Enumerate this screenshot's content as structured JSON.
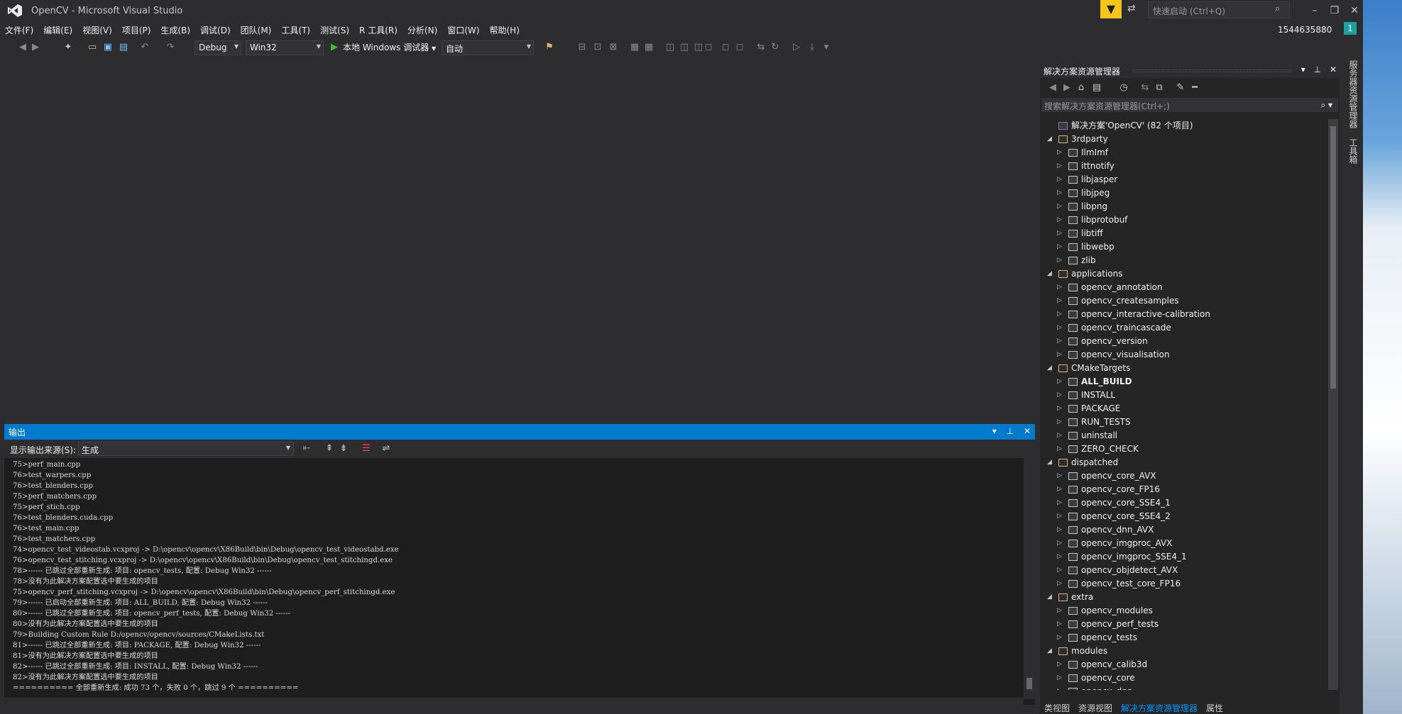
{
  "window": {
    "title": "OpenCV - Microsoft Visual Studio",
    "quick_launch_placeholder": "快速启动 (Ctrl+Q)",
    "user_id": "1544635880",
    "user_badge": "1"
  },
  "menu": [
    "文件(F)",
    "编辑(E)",
    "视图(V)",
    "项目(P)",
    "生成(B)",
    "调试(D)",
    "团队(M)",
    "工具(T)",
    "测试(S)",
    "R 工具(R)",
    "分析(N)",
    "窗口(W)",
    "帮助(H)"
  ],
  "toolbar": {
    "configuration": "Debug",
    "platform": "Win32",
    "run_label": "本地 Windows 调试器",
    "run_mode": "自动"
  },
  "output": {
    "title": "输出",
    "source_label": "显示输出来源(S):",
    "source_value": "生成",
    "lines": [
      "75>perf_main.cpp",
      "76>test_warpers.cpp",
      "76>test_blenders.cpp",
      "75>perf_matchers.cpp",
      "75>perf_stich.cpp",
      "76>test_blenders.cuda.cpp",
      "76>test_main.cpp",
      "76>test_matchers.cpp",
      "74>opencv_test_videostab.vcxproj -> D:\\opencv\\opencv\\X86Build\\bin\\Debug\\opencv_test_videostabd.exe",
      "76>opencv_test_stitching.vcxproj -> D:\\opencv\\opencv\\X86Build\\bin\\Debug\\opencv_test_stitchingd.exe",
      "78>------ 已跳过全部重新生成: 项目: opencv_tests, 配置: Debug Win32 ------",
      "78>没有为此解决方案配置选中要生成的项目",
      "75>opencv_perf_stitching.vcxproj -> D:\\opencv\\opencv\\X86Build\\bin\\Debug\\opencv_perf_stitchingd.exe",
      "79>------ 已启动全部重新生成: 项目: ALL_BUILD, 配置: Debug Win32 ------",
      "80>------ 已跳过全部重新生成: 项目: opencv_perf_tests, 配置: Debug Win32 ------",
      "80>没有为此解决方案配置选中要生成的项目",
      "79>Building Custom Rule D:/opencv/opencv/sources/CMakeLists.txt",
      "81>------ 已跳过全部重新生成: 项目: PACKAGE, 配置: Debug Win32 ------",
      "81>没有为此解决方案配置选中要生成的项目",
      "82>------ 已跳过全部重新生成: 项目: INSTALL, 配置: Debug Win32 ------",
      "82>没有为此解决方案配置选中要生成的项目",
      "========== 全部重新生成: 成功 73 个，失败 0 个，跳过 9 个 =========="
    ]
  },
  "solution_explorer": {
    "title": "解决方案资源管理器",
    "search_placeholder": "搜索解决方案资源管理器(Ctrl+;)",
    "tree": [
      {
        "label": "解决方案'OpenCV' (82 个项目)",
        "level": 0,
        "type": "solution",
        "expanded": true
      },
      {
        "label": "3rdparty",
        "level": 1,
        "type": "folder",
        "expanded": true
      },
      {
        "label": "IlmImf",
        "level": 2,
        "type": "project"
      },
      {
        "label": "ittnotify",
        "level": 2,
        "type": "project"
      },
      {
        "label": "libjasper",
        "level": 2,
        "type": "project"
      },
      {
        "label": "libjpeg",
        "level": 2,
        "type": "project"
      },
      {
        "label": "libpng",
        "level": 2,
        "type": "project"
      },
      {
        "label": "libprotobuf",
        "level": 2,
        "type": "project"
      },
      {
        "label": "libtiff",
        "level": 2,
        "type": "project"
      },
      {
        "label": "libwebp",
        "level": 2,
        "type": "project"
      },
      {
        "label": "zlib",
        "level": 2,
        "type": "project"
      },
      {
        "label": "applications",
        "level": 1,
        "type": "folder",
        "expanded": true
      },
      {
        "label": "opencv_annotation",
        "level": 2,
        "type": "project"
      },
      {
        "label": "opencv_createsamples",
        "level": 2,
        "type": "project"
      },
      {
        "label": "opencv_interactive-calibration",
        "level": 2,
        "type": "project"
      },
      {
        "label": "opencv_traincascade",
        "level": 2,
        "type": "project"
      },
      {
        "label": "opencv_version",
        "level": 2,
        "type": "project"
      },
      {
        "label": "opencv_visualisation",
        "level": 2,
        "type": "project"
      },
      {
        "label": "CMakeTargets",
        "level": 1,
        "type": "folder",
        "expanded": true
      },
      {
        "label": "ALL_BUILD",
        "level": 2,
        "type": "project",
        "bold": true
      },
      {
        "label": "INSTALL",
        "level": 2,
        "type": "project"
      },
      {
        "label": "PACKAGE",
        "level": 2,
        "type": "project"
      },
      {
        "label": "RUN_TESTS",
        "level": 2,
        "type": "project"
      },
      {
        "label": "uninstall",
        "level": 2,
        "type": "project"
      },
      {
        "label": "ZERO_CHECK",
        "level": 2,
        "type": "project"
      },
      {
        "label": "dispatched",
        "level": 1,
        "type": "folder",
        "expanded": true
      },
      {
        "label": "opencv_core_AVX",
        "level": 2,
        "type": "project"
      },
      {
        "label": "opencv_core_FP16",
        "level": 2,
        "type": "project"
      },
      {
        "label": "opencv_core_SSE4_1",
        "level": 2,
        "type": "project"
      },
      {
        "label": "opencv_core_SSE4_2",
        "level": 2,
        "type": "project"
      },
      {
        "label": "opencv_dnn_AVX",
        "level": 2,
        "type": "project"
      },
      {
        "label": "opencv_imgproc_AVX",
        "level": 2,
        "type": "project"
      },
      {
        "label": "opencv_imgproc_SSE4_1",
        "level": 2,
        "type": "project"
      },
      {
        "label": "opencv_objdetect_AVX",
        "level": 2,
        "type": "project"
      },
      {
        "label": "opencv_test_core_FP16",
        "level": 2,
        "type": "project"
      },
      {
        "label": "extra",
        "level": 1,
        "type": "folder",
        "expanded": true
      },
      {
        "label": "opencv_modules",
        "level": 2,
        "type": "project"
      },
      {
        "label": "opencv_perf_tests",
        "level": 2,
        "type": "project"
      },
      {
        "label": "opencv_tests",
        "level": 2,
        "type": "project"
      },
      {
        "label": "modules",
        "level": 1,
        "type": "folder",
        "expanded": true
      },
      {
        "label": "opencv_calib3d",
        "level": 2,
        "type": "project"
      },
      {
        "label": "opencv_core",
        "level": 2,
        "type": "project"
      },
      {
        "label": "opencv_dnn",
        "level": 2,
        "type": "project"
      }
    ],
    "bottom_tabs": [
      "类视图",
      "资源视图",
      "解决方案资源管理器",
      "属性"
    ],
    "active_tab_index": 2
  },
  "right_strip": [
    "服务器资源管理器",
    "工具箱"
  ],
  "colors": {
    "accent": "#007acc",
    "filter": "#f5c518",
    "badge": "#1ba1a1"
  }
}
